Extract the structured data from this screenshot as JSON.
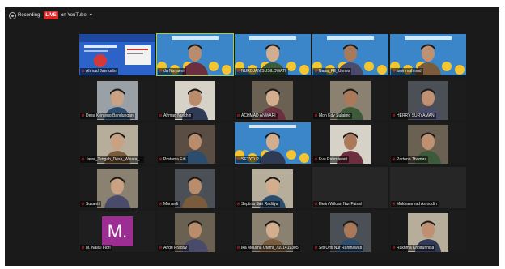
{
  "toolbar": {
    "recording_label": "Recording",
    "live_label": "LIVE",
    "stream_label": "on YouTube"
  },
  "participants": [
    {
      "name": "Ahmad Jaenudin",
      "video": "slide"
    },
    {
      "name": "da Nurjaeni",
      "video": "person-banner",
      "active": true
    },
    {
      "name": "NURDJAN SUSILOWATI",
      "video": "person-banner"
    },
    {
      "name": "Nana_FE_Unnes",
      "video": "person-banner"
    },
    {
      "name": "amir mahmud",
      "video": "person-banner"
    },
    {
      "name": "Desa Kenteng Bandungan",
      "video": "person"
    },
    {
      "name": "Ahmad Nurkhin",
      "video": "person"
    },
    {
      "name": "ACHMAD ANWARI",
      "video": "person"
    },
    {
      "name": "Moh Edy Sulaimo",
      "video": "person"
    },
    {
      "name": "HERRY SURYAMAN",
      "video": "person"
    },
    {
      "name": "Jawa_Tengah_Desa_Wisata_...",
      "video": "person"
    },
    {
      "name": "Pratama Edi",
      "video": "person"
    },
    {
      "name": "SETYO P",
      "video": "person-banner"
    },
    {
      "name": "Eva Rahmawati",
      "video": "person"
    },
    {
      "name": "Partono Thomas",
      "video": "person"
    },
    {
      "name": "Susanti",
      "video": "person"
    },
    {
      "name": "Munardi",
      "video": "person"
    },
    {
      "name": "Septina Sari Raditya",
      "video": "person"
    },
    {
      "name": "Herin Wildan Nur Faisal",
      "video": "off"
    },
    {
      "name": "Mukhammad Asroddin",
      "video": "off"
    },
    {
      "name": "M. Nailul Fiqri",
      "video": "avatar",
      "initial": "M."
    },
    {
      "name": "Andri Pradiwi",
      "video": "person"
    },
    {
      "name": "Ika Moulina Utami_7101419305",
      "video": "person"
    },
    {
      "name": "Siti Umi Nur Rahmawati",
      "video": "person"
    },
    {
      "name": "Rakhma Khoirunnisa",
      "video": "person"
    }
  ],
  "colors": {
    "live": "#e02828",
    "active_speaker": "#9fd13f",
    "avatar_bg": "#9b2d93"
  }
}
